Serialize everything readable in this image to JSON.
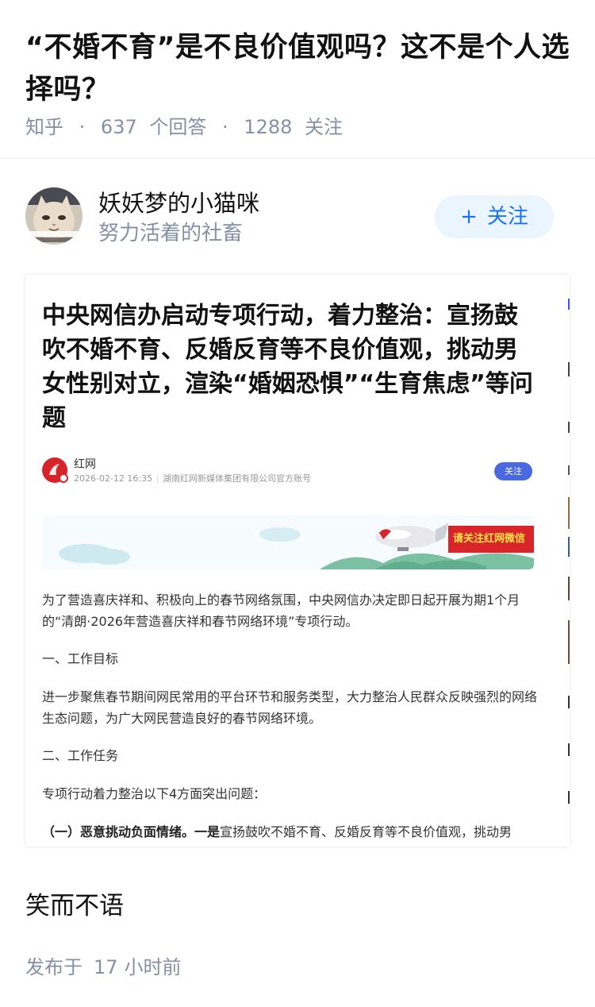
{
  "question": {
    "title": "“不婚不育”是不良价值观吗？这不是个人选择吗？",
    "site": "知乎",
    "answer_count": "637",
    "answer_label": "个回答",
    "follow_count": "1288",
    "follow_label": "关注"
  },
  "author": {
    "name": "妖妖梦的小猫咪",
    "bio": "努力活着的社畜",
    "follow_plus": "+",
    "follow_label": "关注"
  },
  "screenshot": {
    "headline": "中央网信办启动专项行动，着力整治：宣扬鼓吹不婚不育、反婚反育等不良价值观，挑动男女性别对立，渲染“婚姻恐惧”“生育焦虑”等问题",
    "source_name": "红网",
    "source_time": "2026-02-12 16:35",
    "source_desc": "湖南红网新媒体集团有限公司官方账号",
    "source_follow": "关注",
    "banner_text": "请关注红网微信",
    "para1": "为了营造喜庆祥和、积极向上的春节网络氛围，中央网信办决定即日起开展为期1个月的“清朗·2026年营造喜庆祥和春节网络环境”专项行动。",
    "para2": "一、工作目标",
    "para3": "进一步聚焦春节期间网民常用的平台环节和服务类型，大力整治人民群众反映强烈的网络生态问题，为广大网民营造良好的春节网络环境。",
    "para4": "二、工作任务",
    "para5": "专项行动着力整治以下4方面突出问题：",
    "para6_bold1": "（一）恶意挑动负面情绪。",
    "para6_bold2": "一是",
    "para6_rest": "宣扬鼓吹不婚不育、反婚反育等不良价值观，挑动男"
  },
  "answer": {
    "text": "笑而不语",
    "posted_prefix": "发布于",
    "posted_num": "17",
    "posted_unit": "小时前"
  },
  "colors": {
    "primary_text": "#121212",
    "meta_gray": "#8590a6",
    "follow_blue": "#1772f6",
    "follow_bg": "#ebf5fd",
    "source_red": "#d8232a",
    "source_follow_bg": "#4a68e0"
  },
  "icons": {
    "plus": "plus-icon",
    "avatar": "cat-avatar-image",
    "source_logo": "hongwang-logo-icon",
    "banner": "airship-banner-image"
  }
}
